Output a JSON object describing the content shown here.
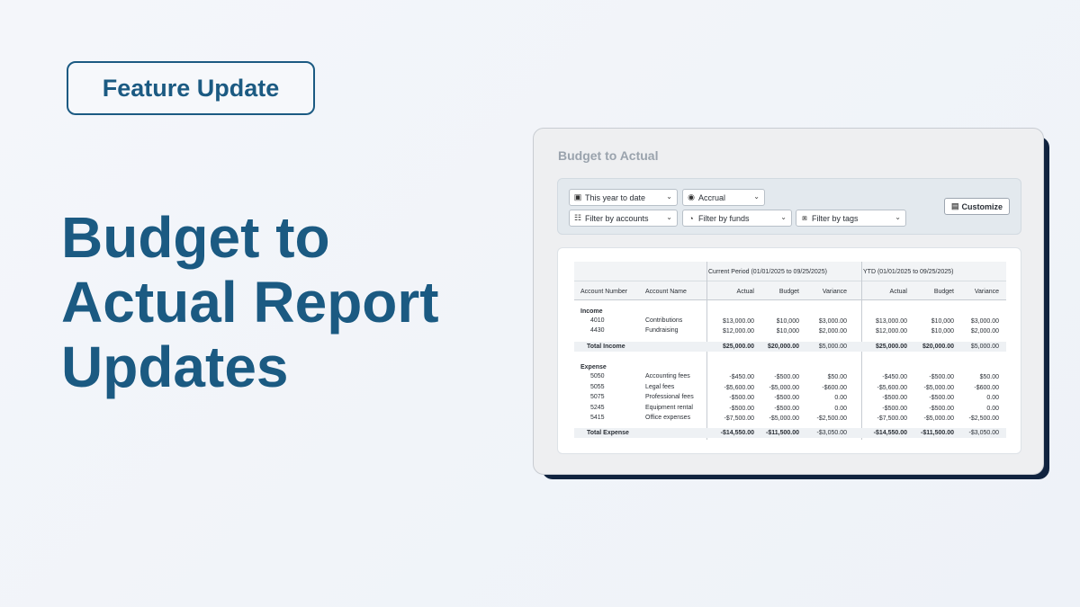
{
  "badge": "Feature Update",
  "headline": [
    "Budget to",
    "Actual Report",
    "Updates"
  ],
  "window": {
    "title": "Budget to Actual",
    "filters": {
      "date_range": "This year to date",
      "basis": "Accrual",
      "accounts": "Filter by accounts",
      "funds": "Filter by funds",
      "tags": "Filter by tags",
      "customize": "Customize"
    },
    "table": {
      "group_headers": [
        "Current Period (01/01/2025 to 09/25/2025)",
        "YTD (01/01/2025 to 09/25/2025)"
      ],
      "columns": [
        "Account Number",
        "Account Name",
        "Actual",
        "Budget",
        "Variance",
        "Actual",
        "Budget",
        "Variance"
      ],
      "income": {
        "label": "Income",
        "rows": [
          {
            "num": "4010",
            "name": "Contributions",
            "v": [
              "$13,000.00",
              "$10,000",
              "$3,000.00",
              "$13,000.00",
              "$10,000",
              "$3,000.00"
            ]
          },
          {
            "num": "4430",
            "name": "Fundraising",
            "v": [
              "$12,000.00",
              "$10,000",
              "$2,000.00",
              "$12,000.00",
              "$10,000",
              "$2,000.00"
            ]
          }
        ],
        "total": {
          "label": "Total Income",
          "v": [
            "$25,000.00",
            "$20,000.00",
            "$5,000.00",
            "$25,000.00",
            "$20,000.00",
            "$5,000.00"
          ]
        }
      },
      "expense": {
        "label": "Expense",
        "rows": [
          {
            "num": "5050",
            "name": "Accounting fees",
            "v": [
              "-$450.00",
              "-$500.00",
              "$50.00",
              "-$450.00",
              "-$500.00",
              "$50.00"
            ]
          },
          {
            "num": "5055",
            "name": "Legal fees",
            "v": [
              "-$5,600.00",
              "-$5,000.00",
              "-$600.00",
              "-$5,600.00",
              "-$5,000.00",
              "-$600.00"
            ]
          },
          {
            "num": "5075",
            "name": "Professional fees",
            "v": [
              "-$500.00",
              "-$500.00",
              "0.00",
              "-$500.00",
              "-$500.00",
              "0.00"
            ]
          },
          {
            "num": "5245",
            "name": "Equipment rental",
            "v": [
              "-$500.00",
              "-$500.00",
              "0.00",
              "-$500.00",
              "-$500.00",
              "0.00"
            ]
          },
          {
            "num": "5415",
            "name": "Office expenses",
            "v": [
              "-$7,500.00",
              "-$5,000.00",
              "-$2,500.00",
              "-$7,500.00",
              "-$5,000.00",
              "-$2,500.00"
            ]
          }
        ],
        "total": {
          "label": "Total Expense",
          "v": [
            "-$14,550.00",
            "-$11,500.00",
            "-$3,050.00",
            "-$14,550.00",
            "-$11,500.00",
            "-$3,050.00"
          ]
        }
      }
    }
  }
}
